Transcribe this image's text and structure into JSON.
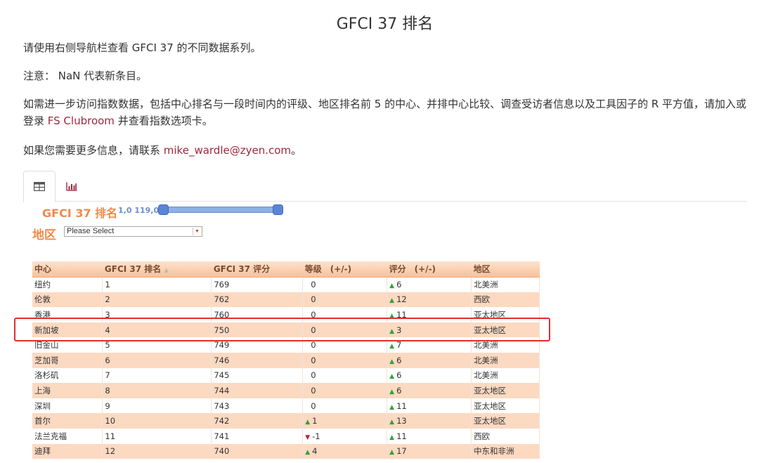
{
  "page": {
    "title": "GFCI 37 排名",
    "intro": "请使用右侧导航栏查看 GFCI 37 的不同数据系列。",
    "note": "注意： NaN 代表新条目。",
    "access_text_1": "如需进一步访问指数数据，包括中心排名与一段时间内的评级、地区排名前 5 的中心、并排中心比较、调查受访者信息以及工具因子的 R 平方值，请加入或登录 ",
    "access_link": "FS Clubroom",
    "access_text_2": " 并查看指数选项卡。",
    "contact_text": "如果您需要更多信息，请联系 ",
    "contact_email": "mike_wardle@zyen.com",
    "contact_end": "。"
  },
  "tabs": [
    {
      "icon": "table-icon",
      "active": true
    },
    {
      "icon": "bar-chart-icon",
      "active": false
    }
  ],
  "filter": {
    "title": "GFCI 37 排名",
    "range_text": "1,0  119,0",
    "range_min": 1,
    "range_max": 119,
    "region_label": "地区",
    "region_placeholder": "Please Select"
  },
  "table": {
    "headers": [
      "中心",
      "GFCI 37 排名",
      "GFCI 37 评分",
      "等级　(+/-)",
      "评分　(+/-)",
      "地区"
    ],
    "rows": [
      [
        "纽约",
        "1",
        "769",
        "0",
        "6",
        "北美洲"
      ],
      [
        "伦敦",
        "2",
        "762",
        "0",
        "12",
        "西欧"
      ],
      [
        "香港",
        "3",
        "760",
        "0",
        "11",
        "亚太地区"
      ],
      [
        "新加坡",
        "4",
        "750",
        "0",
        "3",
        "亚太地区"
      ],
      [
        "旧金山",
        "5",
        "749",
        "0",
        "7",
        "北美洲"
      ],
      [
        "芝加哥",
        "6",
        "746",
        "0",
        "6",
        "北美洲"
      ],
      [
        "洛杉矶",
        "7",
        "745",
        "0",
        "6",
        "北美洲"
      ],
      [
        "上海",
        "8",
        "744",
        "0",
        "6",
        "亚太地区"
      ],
      [
        "深圳",
        "9",
        "743",
        "0",
        "11",
        "亚太地区"
      ],
      [
        "首尔",
        "10",
        "742",
        "1",
        "13",
        "亚太地区"
      ],
      [
        "法兰克福",
        "11",
        "741",
        "-1",
        "11",
        "西欧"
      ],
      [
        "迪拜",
        "12",
        "740",
        "4",
        "17",
        "中东和非洲"
      ]
    ],
    "rank_change_dir": [
      "none",
      "none",
      "none",
      "none",
      "none",
      "none",
      "none",
      "none",
      "none",
      "up",
      "down",
      "up"
    ],
    "score_change_dir": [
      "up",
      "up",
      "up",
      "up",
      "up",
      "up",
      "up",
      "up",
      "up",
      "up",
      "up",
      "up"
    ]
  },
  "colors": {
    "accent_orange": "#f08a4b",
    "link_red": "#a0283a",
    "up_green": "#2fa33a",
    "down_red": "#c0242c",
    "highlight_red": "#e0302e"
  }
}
